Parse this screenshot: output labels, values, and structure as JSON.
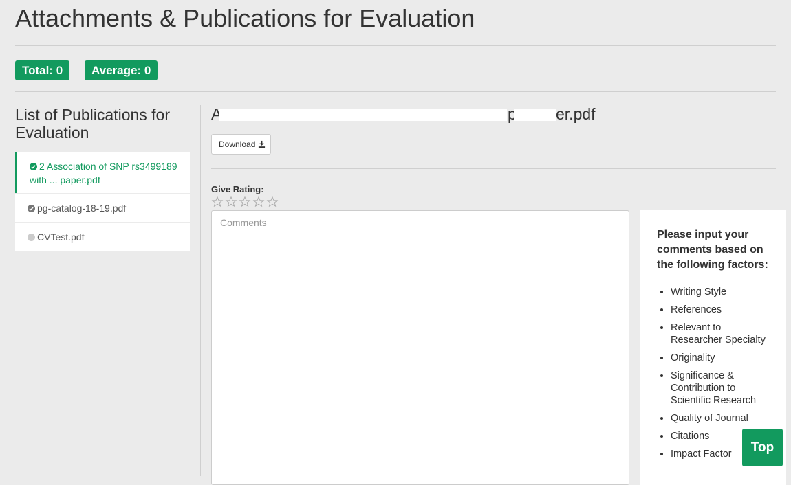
{
  "page": {
    "title": "Attachments & Publications for Evaluation"
  },
  "summary": {
    "total_label": "Total: 0",
    "average_label": "Average: 0"
  },
  "sidebar": {
    "heading": "List of Publications for Evaluation",
    "items": [
      {
        "label": "2 Association of SNP rs3499189 with ... paper.pdf",
        "line1": "2 Association of SNP rs3499189",
        "line2": "with ... paper.pdf",
        "status": "checked",
        "active": true
      },
      {
        "label": "pg-catalog-18-19.pdf",
        "status": "checked",
        "active": false
      },
      {
        "label": "CVTest.pdf",
        "status": "pending",
        "active": false
      }
    ]
  },
  "document": {
    "title_prefix": "A",
    "title_suffix": "er.pdf",
    "title_fragment": "p",
    "download_label": "Download"
  },
  "rating": {
    "label": "Give Rating:",
    "max_stars": 5,
    "value": 0
  },
  "comments": {
    "placeholder": "Comments",
    "value": ""
  },
  "guidelines": {
    "heading": "Please input your comments based on the following factors:",
    "factors": [
      "Writing Style",
      "References",
      "Relevant to Researcher Specialty",
      "Originality",
      "Significance & Contribution to Scientific Research",
      "Quality of Journal",
      "Citations",
      "Impact Factor"
    ]
  },
  "top_button": {
    "label": "Top"
  },
  "colors": {
    "accent": "#129a5e",
    "background": "#ebebeb"
  }
}
